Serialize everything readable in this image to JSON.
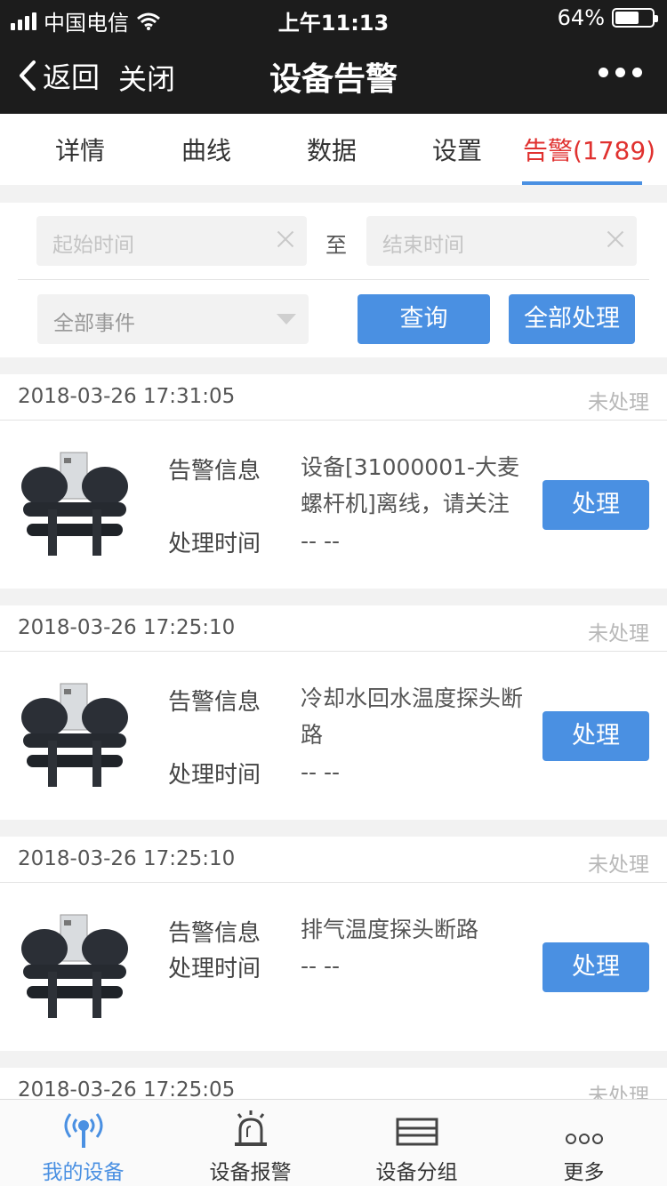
{
  "status_bar": {
    "carrier": "中国电信",
    "time": "上午11:13",
    "battery": "64%",
    "battery_level": 0.64
  },
  "nav": {
    "back_label": "返回",
    "close_label": "关闭",
    "title": "设备告警"
  },
  "tabs": [
    {
      "label": "详情"
    },
    {
      "label": "曲线"
    },
    {
      "label": "数据"
    },
    {
      "label": "设置"
    },
    {
      "label": "告警(1789)",
      "active": true
    }
  ],
  "filters": {
    "start_placeholder": "起始时间",
    "to_label": "至",
    "end_placeholder": "结束时间",
    "event_select": "全部事件",
    "query_label": "查询",
    "handle_all_label": "全部处理"
  },
  "labels": {
    "info": "告警信息",
    "handle_time": "处理时间",
    "handle_btn": "处理"
  },
  "alarms": [
    {
      "timestamp": "2018-03-26 17:31:05",
      "status": "未处理",
      "message": "设备[31000001-大麦螺杆机]离线，请关注",
      "handle_time": "-- --"
    },
    {
      "timestamp": "2018-03-26 17:25:10",
      "status": "未处理",
      "message": "冷却水回水温度探头断路",
      "handle_time": "-- --"
    },
    {
      "timestamp": "2018-03-26 17:25:10",
      "status": "未处理",
      "message": "排气温度探头断路",
      "handle_time": "-- --"
    },
    {
      "timestamp": "2018-03-26 17:25:05",
      "status": "未处理"
    }
  ],
  "bottom_nav": [
    {
      "label": "我的设备",
      "icon": "antenna-icon",
      "active": true
    },
    {
      "label": "设备报警",
      "icon": "alarm-light-icon"
    },
    {
      "label": "设备分组",
      "icon": "group-icon"
    },
    {
      "label": "更多",
      "icon": "more-dots-icon"
    }
  ],
  "colors": {
    "accent": "#4a90e2",
    "alarm_red": "#e0312f",
    "header_bg": "#1c1c1c"
  }
}
